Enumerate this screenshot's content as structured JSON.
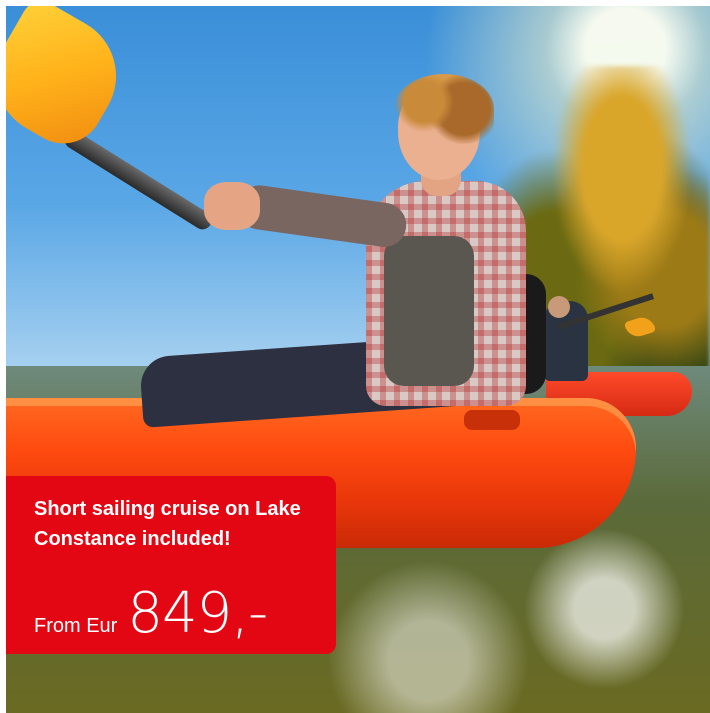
{
  "offer": {
    "headline": "Short sailing cruise on Lake Constance included!",
    "price_prefix": "From Eur",
    "price": "849,-"
  },
  "colors": {
    "offer_background": "#e30613",
    "offer_text": "#ffffff",
    "kayak": "#ff4a10",
    "paddle_blade": "#ffb21a"
  }
}
